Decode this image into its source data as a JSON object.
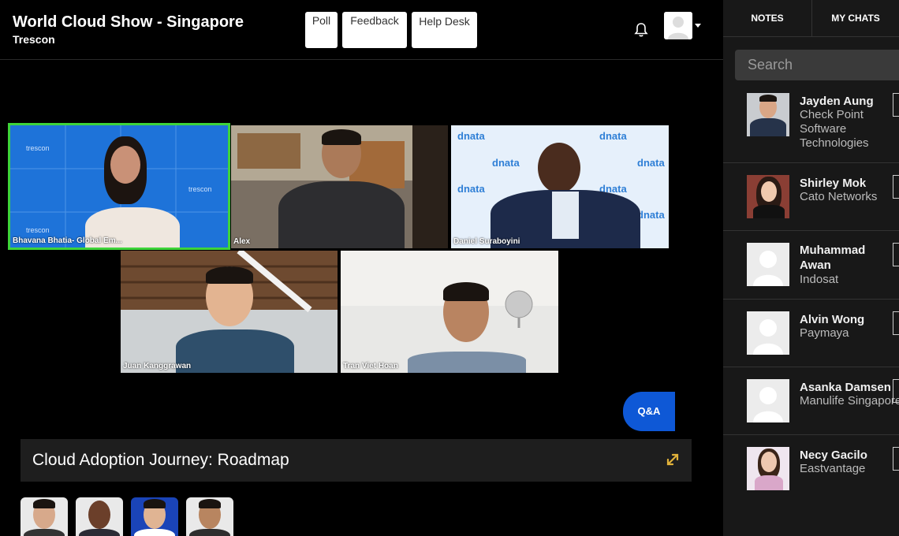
{
  "header": {
    "title": "World Cloud Show - Singapore",
    "organizer": "Trescon",
    "buttons": {
      "poll": "Poll",
      "feedback": "Feedback",
      "help_desk": "Help Desk"
    },
    "notification_icon": "bell-icon",
    "user_icon": "avatar-placeholder-icon"
  },
  "video": {
    "participants": [
      {
        "name": "Bhavana Bhatia- Global Em...",
        "active_speaker": true,
        "backdrop_label": "trescon"
      },
      {
        "name": "Alex"
      },
      {
        "name": "Daniel Suraboyini",
        "backdrop_label": "dnata"
      },
      {
        "name": "Juan Kanggrawan"
      },
      {
        "name": "Tran Viet Hoan"
      }
    ],
    "active_speaker_color": "#3ed43a"
  },
  "qa_button": "Q&A",
  "session": {
    "title": "Cloud Adoption Journey: Roadmap",
    "expand_icon": "expand-arrows-icon",
    "accent": "#e1b23a"
  },
  "speakers": {
    "count": 4
  },
  "panel": {
    "tabs": [
      "NOTES",
      "MY CHATS"
    ],
    "search_placeholder": "Search",
    "contacts": [
      {
        "name": "Jayden Aung",
        "company": [
          "Check Point",
          "Software",
          "Technologies"
        ],
        "has_photo": true
      },
      {
        "name": "Shirley Mok",
        "company": [
          "Cato Networks"
        ],
        "has_photo": true
      },
      {
        "name": [
          "Muhammad",
          "Awan"
        ],
        "company": [
          "Indosat"
        ],
        "has_photo": false
      },
      {
        "name": "Alvin Wong",
        "company": [
          "Paymaya"
        ],
        "has_photo": false
      },
      {
        "name": "Asanka Damsen",
        "company": [
          "Manulife Singapore"
        ],
        "has_photo": false
      },
      {
        "name": "Necy Gacilo",
        "company": [
          "Eastvantage"
        ],
        "has_photo": true
      }
    ]
  }
}
